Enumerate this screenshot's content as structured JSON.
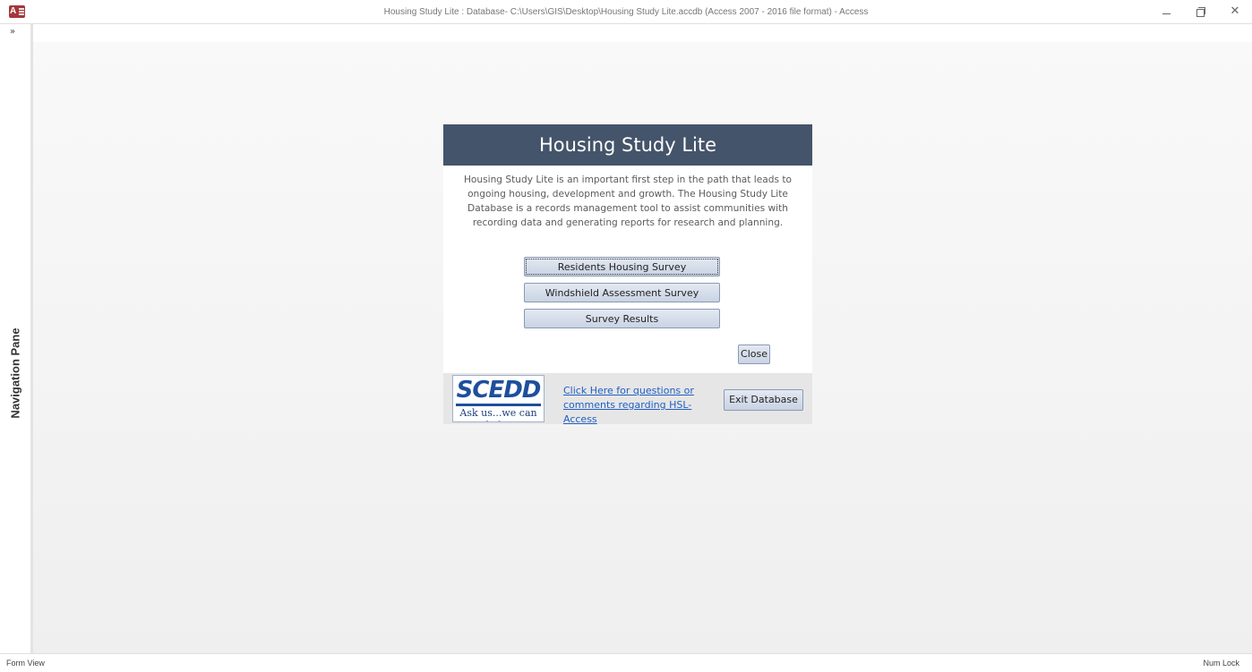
{
  "window": {
    "title": "Housing Study Lite : Database- C:\\Users\\GIS\\Desktop\\Housing Study Lite.accdb (Access 2007 - 2016 file format) - Access",
    "controls": {
      "minimize": "–",
      "close": "✕"
    }
  },
  "nav_pane": {
    "toggle": "»",
    "label": "Navigation Pane"
  },
  "form": {
    "title": "Housing Study Lite",
    "description": "Housing Study Lite is an important first step in the path that leads to ongoing housing, development and growth.  The Housing Study Lite Database is a records management tool to assist communities with recording data and generating reports for research and planning.",
    "buttons": [
      {
        "label": "Residents Housing Survey"
      },
      {
        "label": "Windshield Assessment Survey"
      },
      {
        "label": "Survey Results"
      }
    ],
    "close_label": "Close",
    "footer": {
      "logo_text": "SCEDD",
      "logo_tagline": "Ask us...we can help.",
      "link_text": "Click Here for questions or comments regarding HSL-Access",
      "exit_label": "Exit Database"
    }
  },
  "status": {
    "view": "Form View",
    "num_lock": "Num Lock"
  },
  "colors": {
    "header_bg": "#44546a",
    "link": "#1f5fc4",
    "button_border": "#8a9ab4"
  }
}
